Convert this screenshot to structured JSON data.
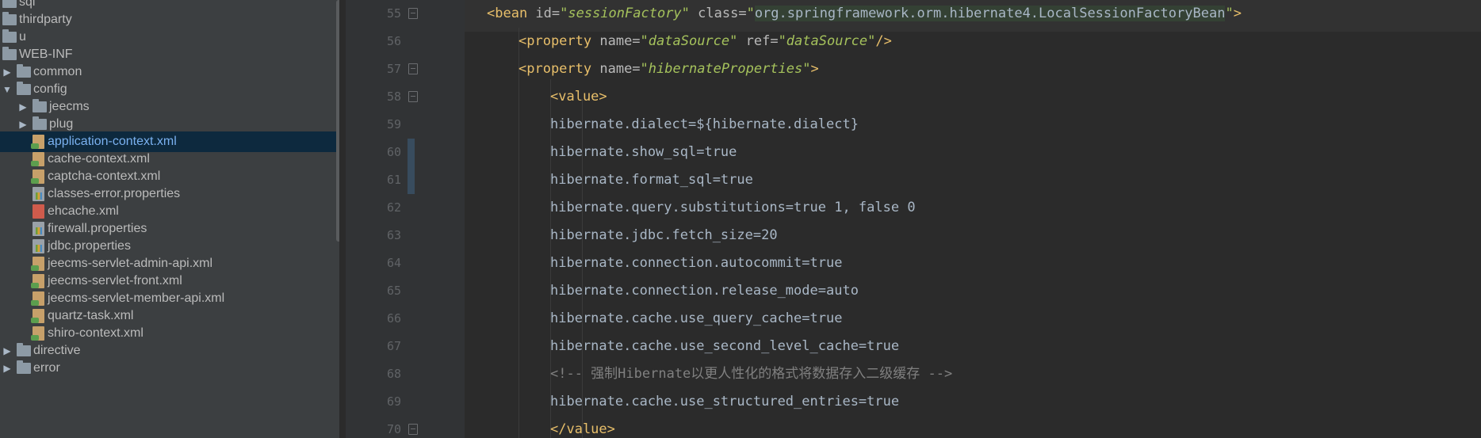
{
  "project_tree": {
    "items": [
      {
        "label": "sql",
        "type": "folder",
        "expandable": false
      },
      {
        "label": "thirdparty",
        "type": "folder",
        "expandable": false
      },
      {
        "label": "u",
        "type": "folder",
        "expandable": false
      },
      {
        "label": "WEB-INF",
        "type": "folder",
        "expandable": false
      },
      {
        "label": "common",
        "type": "folder",
        "expandable": true,
        "expanded": false
      },
      {
        "label": "config",
        "type": "folder",
        "expandable": true,
        "expanded": true
      },
      {
        "label": "jeecms",
        "type": "folder",
        "expandable": true,
        "expanded": false
      },
      {
        "label": "plug",
        "type": "folder",
        "expandable": true,
        "expanded": false
      },
      {
        "label": "application-context.xml",
        "type": "xml-spring",
        "selected": true
      },
      {
        "label": "cache-context.xml",
        "type": "xml-spring"
      },
      {
        "label": "captcha-context.xml",
        "type": "xml-spring"
      },
      {
        "label": "classes-error.properties",
        "type": "properties"
      },
      {
        "label": "ehcache.xml",
        "type": "xml"
      },
      {
        "label": "firewall.properties",
        "type": "properties"
      },
      {
        "label": "jdbc.properties",
        "type": "properties"
      },
      {
        "label": "jeecms-servlet-admin-api.xml",
        "type": "xml-spring"
      },
      {
        "label": "jeecms-servlet-front.xml",
        "type": "xml-spring"
      },
      {
        "label": "jeecms-servlet-member-api.xml",
        "type": "xml-spring"
      },
      {
        "label": "quartz-task.xml",
        "type": "xml-spring"
      },
      {
        "label": "shiro-context.xml",
        "type": "xml-spring"
      },
      {
        "label": "directive",
        "type": "folder",
        "expandable": true,
        "expanded": false
      },
      {
        "label": "error",
        "type": "folder",
        "expandable": true,
        "expanded": false
      }
    ]
  },
  "editor": {
    "lines": [
      {
        "num": "55",
        "parts": [
          [
            "tag",
            "<bean "
          ],
          [
            "attr",
            "id="
          ],
          [
            "val",
            "\"sessionFactory\""
          ],
          [
            "attr",
            " class="
          ],
          [
            "val",
            "\""
          ],
          [
            "hl",
            "org.springframework.orm.hibernate4.LocalSessionFactoryBean"
          ],
          [
            "val",
            "\""
          ],
          [
            "tag",
            ">"
          ]
        ]
      },
      {
        "num": "56",
        "parts": [
          [
            "tag",
            "<property "
          ],
          [
            "attr",
            "name="
          ],
          [
            "val",
            "\"dataSource\""
          ],
          [
            "attr",
            " ref="
          ],
          [
            "val",
            "\"dataSource\""
          ],
          [
            "tag",
            "/>"
          ]
        ]
      },
      {
        "num": "57",
        "parts": [
          [
            "tag",
            "<property "
          ],
          [
            "attr",
            "name="
          ],
          [
            "val",
            "\"hibernateProperties\""
          ],
          [
            "tag",
            ">"
          ]
        ]
      },
      {
        "num": "58",
        "parts": [
          [
            "tag",
            "<value>"
          ]
        ]
      },
      {
        "num": "59",
        "parts": [
          [
            "txt",
            "hibernate.dialect=${hibernate.dialect}"
          ]
        ]
      },
      {
        "num": "60",
        "parts": [
          [
            "txt",
            "hibernate.show_sql=true"
          ]
        ]
      },
      {
        "num": "61",
        "parts": [
          [
            "txt",
            "hibernate.format_sql=true"
          ]
        ]
      },
      {
        "num": "62",
        "parts": [
          [
            "txt",
            "hibernate.query.substitutions=true 1, false 0"
          ]
        ]
      },
      {
        "num": "63",
        "parts": [
          [
            "txt",
            "hibernate.jdbc.fetch_size=20"
          ]
        ]
      },
      {
        "num": "64",
        "parts": [
          [
            "txt",
            "hibernate.connection.autocommit=true"
          ]
        ]
      },
      {
        "num": "65",
        "parts": [
          [
            "txt",
            "hibernate.connection.release_mode=auto"
          ]
        ]
      },
      {
        "num": "66",
        "parts": [
          [
            "txt",
            "hibernate.cache.use_query_cache=true"
          ]
        ]
      },
      {
        "num": "67",
        "parts": [
          [
            "txt",
            "hibernate.cache.use_second_level_cache=true"
          ]
        ]
      },
      {
        "num": "68",
        "parts": [
          [
            "comment",
            "<!-- 强制Hibernate以更人性化的格式将数据存入二级缓存 -->"
          ]
        ]
      },
      {
        "num": "69",
        "parts": [
          [
            "txt",
            "hibernate.cache.use_structured_entries=true"
          ]
        ]
      },
      {
        "num": "70",
        "parts": [
          [
            "tag",
            "</value>"
          ]
        ]
      }
    ]
  }
}
